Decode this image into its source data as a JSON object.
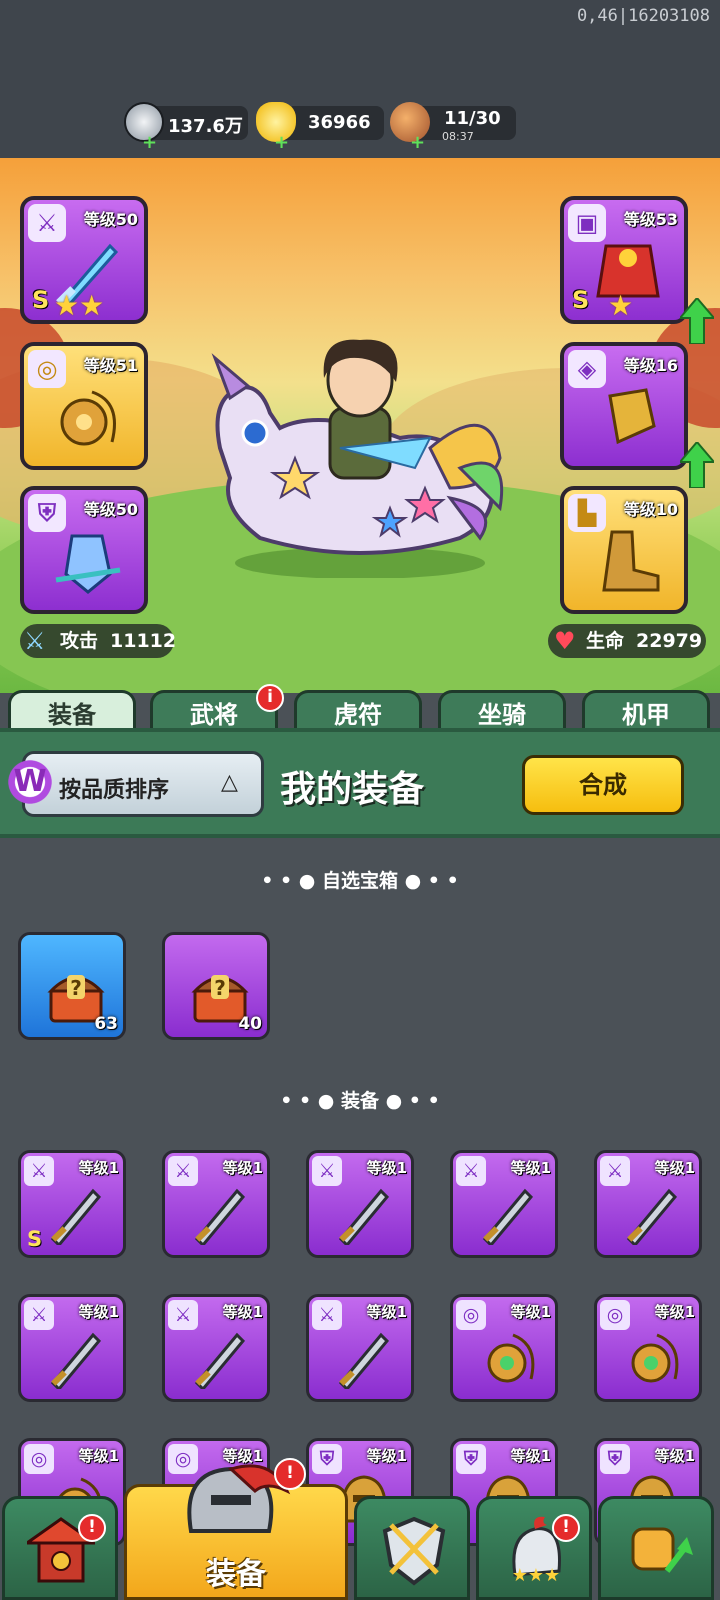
{
  "debug_text": "0,46|16203108",
  "resources": {
    "silver": {
      "value": "137.6万",
      "icon": "silver-coin-icon"
    },
    "gold": {
      "value": "36966",
      "icon": "gold-ingot-icon"
    },
    "stamina": {
      "value": "11/30",
      "timer": "08:37",
      "icon": "meat-icon"
    }
  },
  "hero": {
    "attack_label": "攻击",
    "attack_value": "11112",
    "hp_label": "生命",
    "hp_value": "22979"
  },
  "slots": {
    "weapon": {
      "level": "等级50",
      "grade": "S",
      "stars": "★★"
    },
    "amulet": {
      "level": "等级51"
    },
    "helmet": {
      "level": "等级50"
    },
    "armor": {
      "level": "等级53",
      "grade": "S",
      "stars": "★"
    },
    "bracer": {
      "level": "等级16"
    },
    "boots": {
      "level": "等级10"
    }
  },
  "tabs": [
    "装备",
    "武将",
    "虎符",
    "坐骑",
    "机甲"
  ],
  "tab_badge": "i",
  "sort_label": "按品质排序",
  "section_title": "我的装备",
  "compose_label": "合成",
  "watermark": "W",
  "chest_section": "自选宝箱",
  "chests": [
    {
      "count": "63",
      "color": "blue"
    },
    {
      "count": "40",
      "color": "purple"
    }
  ],
  "equip_section": "装备",
  "equip_items": [
    {
      "level": "等级1",
      "grade": "S",
      "icon": "sword"
    },
    {
      "level": "等级1",
      "icon": "sword"
    },
    {
      "level": "等级1",
      "icon": "sword"
    },
    {
      "level": "等级1",
      "icon": "sword"
    },
    {
      "level": "等级1",
      "icon": "sword"
    },
    {
      "level": "等级1",
      "icon": "sword"
    },
    {
      "level": "等级1",
      "icon": "sword"
    },
    {
      "level": "等级1",
      "icon": "sword"
    },
    {
      "level": "等级1",
      "icon": "amulet"
    },
    {
      "level": "等级1",
      "icon": "amulet"
    },
    {
      "level": "等级1",
      "icon": "amulet"
    },
    {
      "level": "等级1",
      "icon": "amulet"
    },
    {
      "level": "等级1",
      "icon": "helmet"
    },
    {
      "level": "等级1",
      "icon": "helmet"
    },
    {
      "level": "等级1",
      "icon": "helmet"
    }
  ],
  "nav": {
    "active_label": "装备",
    "badge": "!"
  }
}
